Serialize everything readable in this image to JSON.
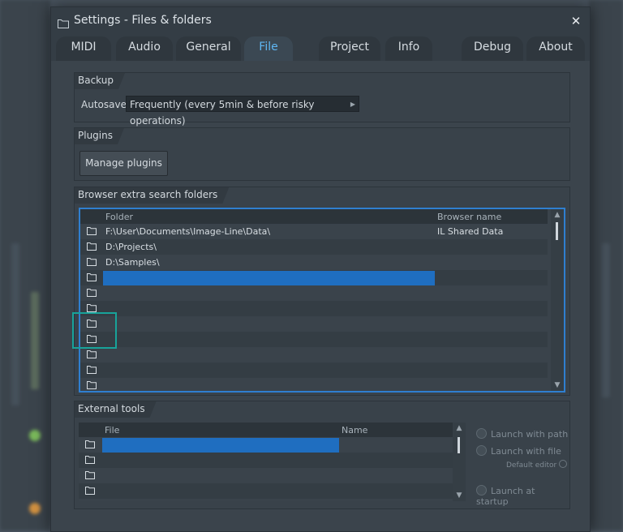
{
  "window": {
    "title": "Settings - Files & folders",
    "close_glyph": "✕"
  },
  "tabs": [
    {
      "label": "MIDI",
      "active": false
    },
    {
      "label": "Audio",
      "active": false
    },
    {
      "label": "General",
      "active": false
    },
    {
      "label": "File",
      "active": true
    },
    {
      "label": "Project",
      "active": false
    },
    {
      "label": "Info",
      "active": false
    },
    {
      "label": "Debug",
      "active": false
    },
    {
      "label": "About",
      "active": false
    }
  ],
  "backup": {
    "section_label": "Backup",
    "autosave_label": "Autosave",
    "autosave_value": "Frequently (every 5min & before risky operations)"
  },
  "plugins": {
    "section_label": "Plugins",
    "manage_button": "Manage plugins"
  },
  "browser_folders": {
    "section_label": "Browser extra search folders",
    "col_folder": "Folder",
    "col_browser_name": "Browser name",
    "rows": [
      {
        "folder": "F:\\User\\Documents\\Image-Line\\Data\\",
        "browser_name": "IL Shared Data",
        "selected": false
      },
      {
        "folder": "D:\\Projects\\",
        "browser_name": "",
        "selected": false
      },
      {
        "folder": "D:\\Samples\\",
        "browser_name": "",
        "selected": false
      },
      {
        "folder": "",
        "browser_name": "",
        "selected": true
      },
      {
        "folder": "",
        "browser_name": "",
        "selected": false
      },
      {
        "folder": "",
        "browser_name": "",
        "selected": false
      },
      {
        "folder": "",
        "browser_name": "",
        "selected": false
      },
      {
        "folder": "",
        "browser_name": "",
        "selected": false
      },
      {
        "folder": "",
        "browser_name": "",
        "selected": false
      },
      {
        "folder": "",
        "browser_name": "",
        "selected": false
      },
      {
        "folder": "",
        "browser_name": "",
        "selected": false
      }
    ]
  },
  "external_tools": {
    "section_label": "External tools",
    "col_file": "File",
    "col_name": "Name",
    "rows": [
      {
        "file": "",
        "name": "",
        "selected": true
      },
      {
        "file": "",
        "name": "",
        "selected": false
      },
      {
        "file": "",
        "name": "",
        "selected": false
      },
      {
        "file": "",
        "name": "",
        "selected": false
      }
    ],
    "launch_with_path": "Launch with path",
    "launch_with_file": "Launch with file",
    "default_editor": "Default editor",
    "launch_at_startup": "Launch at startup"
  },
  "colors": {
    "accent": "#2f7fd0",
    "selection": "#1f6ec0",
    "active_tab_text": "#5fb6f2",
    "highlight_box": "#18a39a"
  },
  "icons": {
    "folder": "folder-icon",
    "close": "close-icon",
    "scroll_up": "chevron-up-icon",
    "scroll_down": "chevron-down-icon",
    "dropdown": "caret-right-icon"
  }
}
